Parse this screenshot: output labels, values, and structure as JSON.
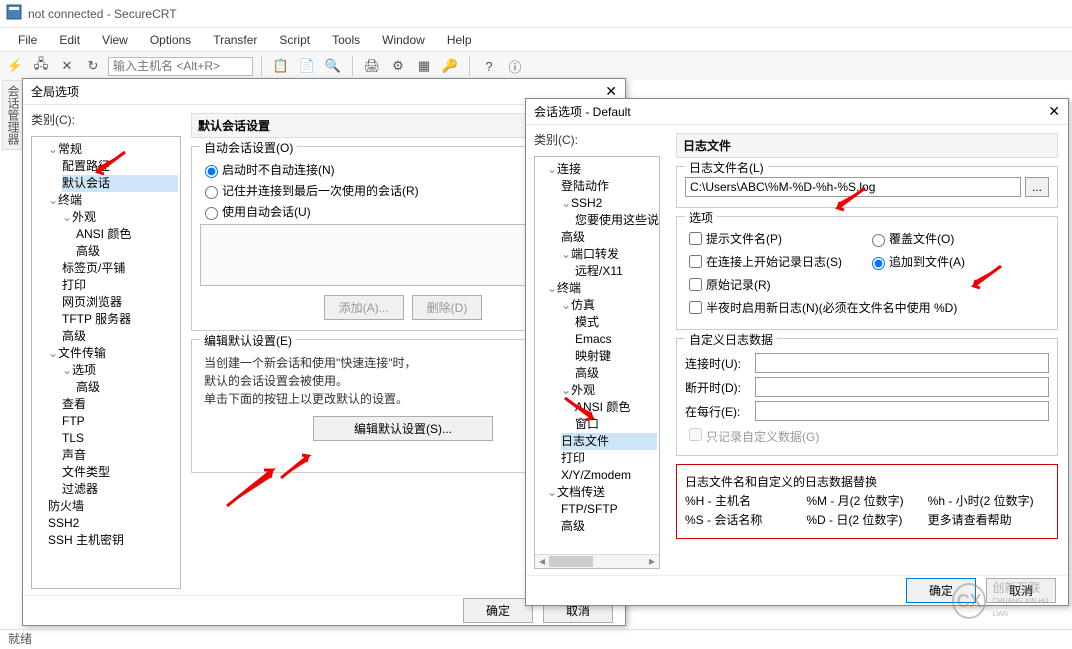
{
  "window": {
    "title": "not connected - SecureCRT"
  },
  "menus": [
    "File",
    "Edit",
    "View",
    "Options",
    "Transfer",
    "Script",
    "Tools",
    "Window",
    "Help"
  ],
  "toolbar_placeholder": "输入主机名 <Alt+R>",
  "left_tab": "会话管理器",
  "dlg1": {
    "title": "全局选项",
    "tree_label": "类别(C):",
    "tree": {
      "general": "常规",
      "config_path": "配置路径",
      "default_session": "默认会话",
      "terminal": "终端",
      "appearance": "外观",
      "ansi_color": "ANSI 颜色",
      "advanced": "高级",
      "tabs": "标签页/平铺",
      "print": "打印",
      "web_browser": "网页浏览器",
      "tftp": "TFTP 服务器",
      "advanced2": "高级",
      "filetransfer": "文件传输",
      "options": "选项",
      "advanced3": "高级",
      "view": "查看",
      "ftp": "FTP",
      "tls": "TLS",
      "sound": "声音",
      "filetypes": "文件类型",
      "filters": "过滤器",
      "firewall": "防火墙",
      "ssh2": "SSH2",
      "sshkeys": "SSH 主机密钥"
    },
    "content_title": "默认会话设置",
    "auto_session": {
      "legend": "自动会话设置(O)",
      "r1": "启动时不自动连接(N)",
      "r2": "记住并连接到最后一次使用的会话(R)",
      "r3": "使用自动会话(U)"
    },
    "add_btn": "添加(A)...",
    "del_btn": "删除(D)",
    "edit_group": {
      "legend": "编辑默认设置(E)",
      "help1": "当创建一个新会话和使用\"快速连接\"时，",
      "help2": "默认的会话设置会被使用。",
      "help3": "单击下面的按钮上以更改默认的设置。",
      "btn": "编辑默认设置(S)..."
    },
    "ok": "确定",
    "cancel": "取消"
  },
  "dlg2": {
    "title": "会话选项 - Default",
    "tree_label": "类别(C):",
    "tree": {
      "connection": "连接",
      "logon": "登陆动作",
      "ssh2": "SSH2",
      "ssh2_hint": "您要使用这些说",
      "advanced": "高级",
      "portfwd": "端口转发",
      "remote_x11": "远程/X11",
      "terminal": "终端",
      "emulation": "仿真",
      "mode": "模式",
      "emacs": "Emacs",
      "mapkey": "映射键",
      "advanced2": "高级",
      "appearance": "外观",
      "ansi_color": "ANSI 颜色",
      "window": "窗口",
      "logfile": "日志文件",
      "print": "打印",
      "xyz": "X/Y/Zmodem",
      "doctransfer": "文档传送",
      "ftpsftp": "FTP/SFTP",
      "advanced3": "高级"
    },
    "content_title": "日志文件",
    "log": {
      "name_label": "日志文件名(L)",
      "name_value": "C:\\Users\\ABC\\%M-%D-%h-%S.log",
      "options_legend": "选项",
      "o_prompt": "提示文件名(P)",
      "o_overwrite": "覆盖文件(O)",
      "o_start_on_connect": "在连接上开始记录日志(S)",
      "o_append": "追加到文件(A)",
      "o_rawlog": "原始记录(R)",
      "o_midnight": "半夜时启用新日志(N)(必须在文件名中使用 %D)",
      "cd_legend": "自定义日志数据",
      "cd_connect": "连接时(U):",
      "cd_disconnect": "断开时(D):",
      "cd_eachline": "在每行(E):",
      "cd_only_custom": "只记录自定义数据(G)",
      "subst_title": "日志文件名和自定义的日志数据替换",
      "s_h": "%H - 主机名",
      "s_m": "%M - 月(2 位数字)",
      "s_hh": "%h - 小时(2 位数字)",
      "s_s": "%S - 会话名称",
      "s_d": "%D - 日(2 位数字)",
      "s_more": "更多请查看帮助"
    },
    "ok": "确定",
    "cancel": "取消"
  },
  "status": "就绪",
  "watermark": {
    "brand": "创新互联",
    "sub": "CHUANG XIN HU LIAN"
  }
}
